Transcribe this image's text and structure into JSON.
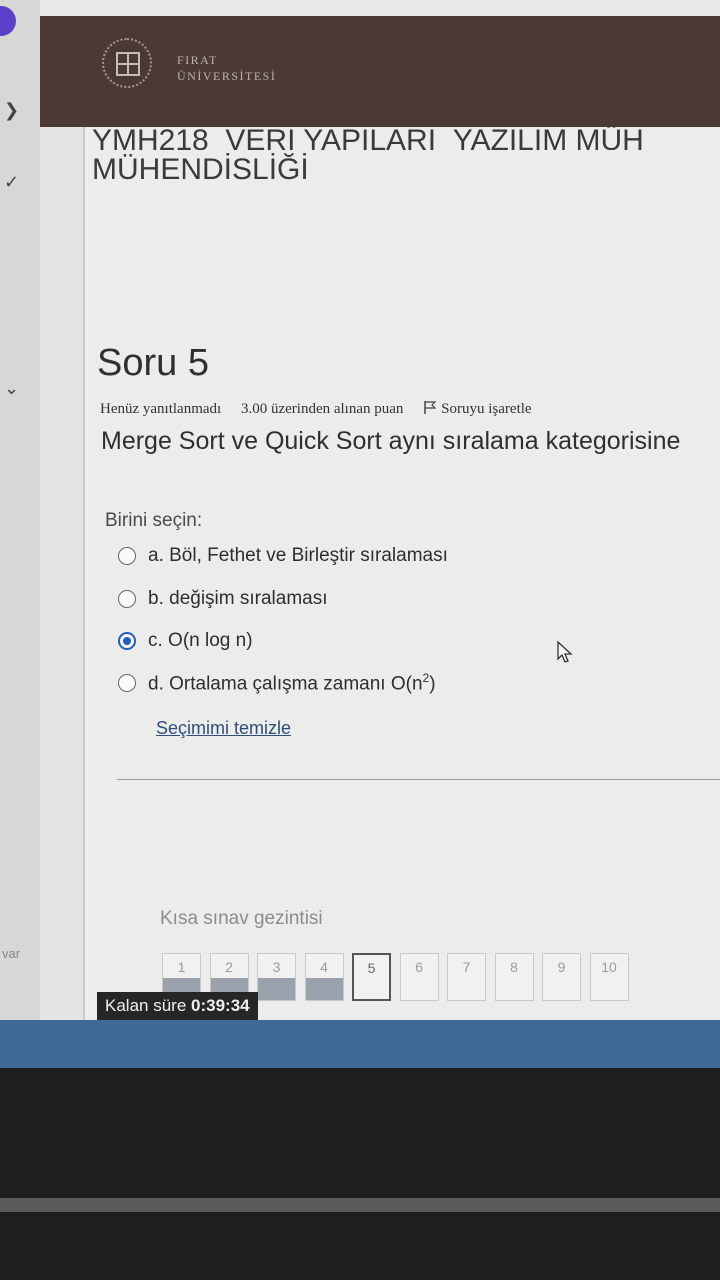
{
  "university": {
    "name_line1": "FIRAT",
    "name_line2": "ÜNİVERSİTESİ"
  },
  "course": {
    "title_line1": "YMH218_VERİ YAPILARI_YAZILIM MÜH",
    "title_line2": "MÜHENDİSLİĞİ"
  },
  "question": {
    "title": "Soru 5",
    "status": "Henüz yanıtlanmadı",
    "points": "3.00 üzerinden alınan puan",
    "flag_label": "Soruyu işaretle",
    "text": "Merge Sort ve Quick Sort aynı sıralama kategorisine",
    "choose_label": "Birini seçin:",
    "options": [
      {
        "label": "a. Böl, Fethet ve Birleştir sıralaması",
        "selected": false
      },
      {
        "label": "b. değişim sıralaması",
        "selected": false
      },
      {
        "label": "c. O(n log n)",
        "selected": true
      },
      {
        "label_prefix": "d. Ortalama çalışma zamanı O(n",
        "label_sup": "2",
        "label_suffix": ")",
        "selected": false
      }
    ],
    "clear_label": "Seçimimi temizle"
  },
  "quiz_nav": {
    "title": "Kısa sınav gezintisi",
    "pages": [
      {
        "label": "1",
        "answered": true,
        "current": false
      },
      {
        "label": "2",
        "answered": true,
        "current": false
      },
      {
        "label": "3",
        "answered": true,
        "current": false
      },
      {
        "label": "4",
        "answered": true,
        "current": false
      },
      {
        "label": "5",
        "answered": false,
        "current": true
      },
      {
        "label": "6",
        "answered": false,
        "current": false
      },
      {
        "label": "7",
        "answered": false,
        "current": false
      },
      {
        "label": "8",
        "answered": false,
        "current": false
      },
      {
        "label": "9",
        "answered": false,
        "current": false
      },
      {
        "label": "10",
        "answered": false,
        "current": false
      }
    ]
  },
  "timer": {
    "label": "Kalan süre",
    "value": "0:39:34"
  },
  "sidebar": {
    "partial_text": "var"
  },
  "colors": {
    "header_bg": "#4b3a34",
    "accent": "#1f5fbf",
    "taskbar": "#3d6a96"
  }
}
